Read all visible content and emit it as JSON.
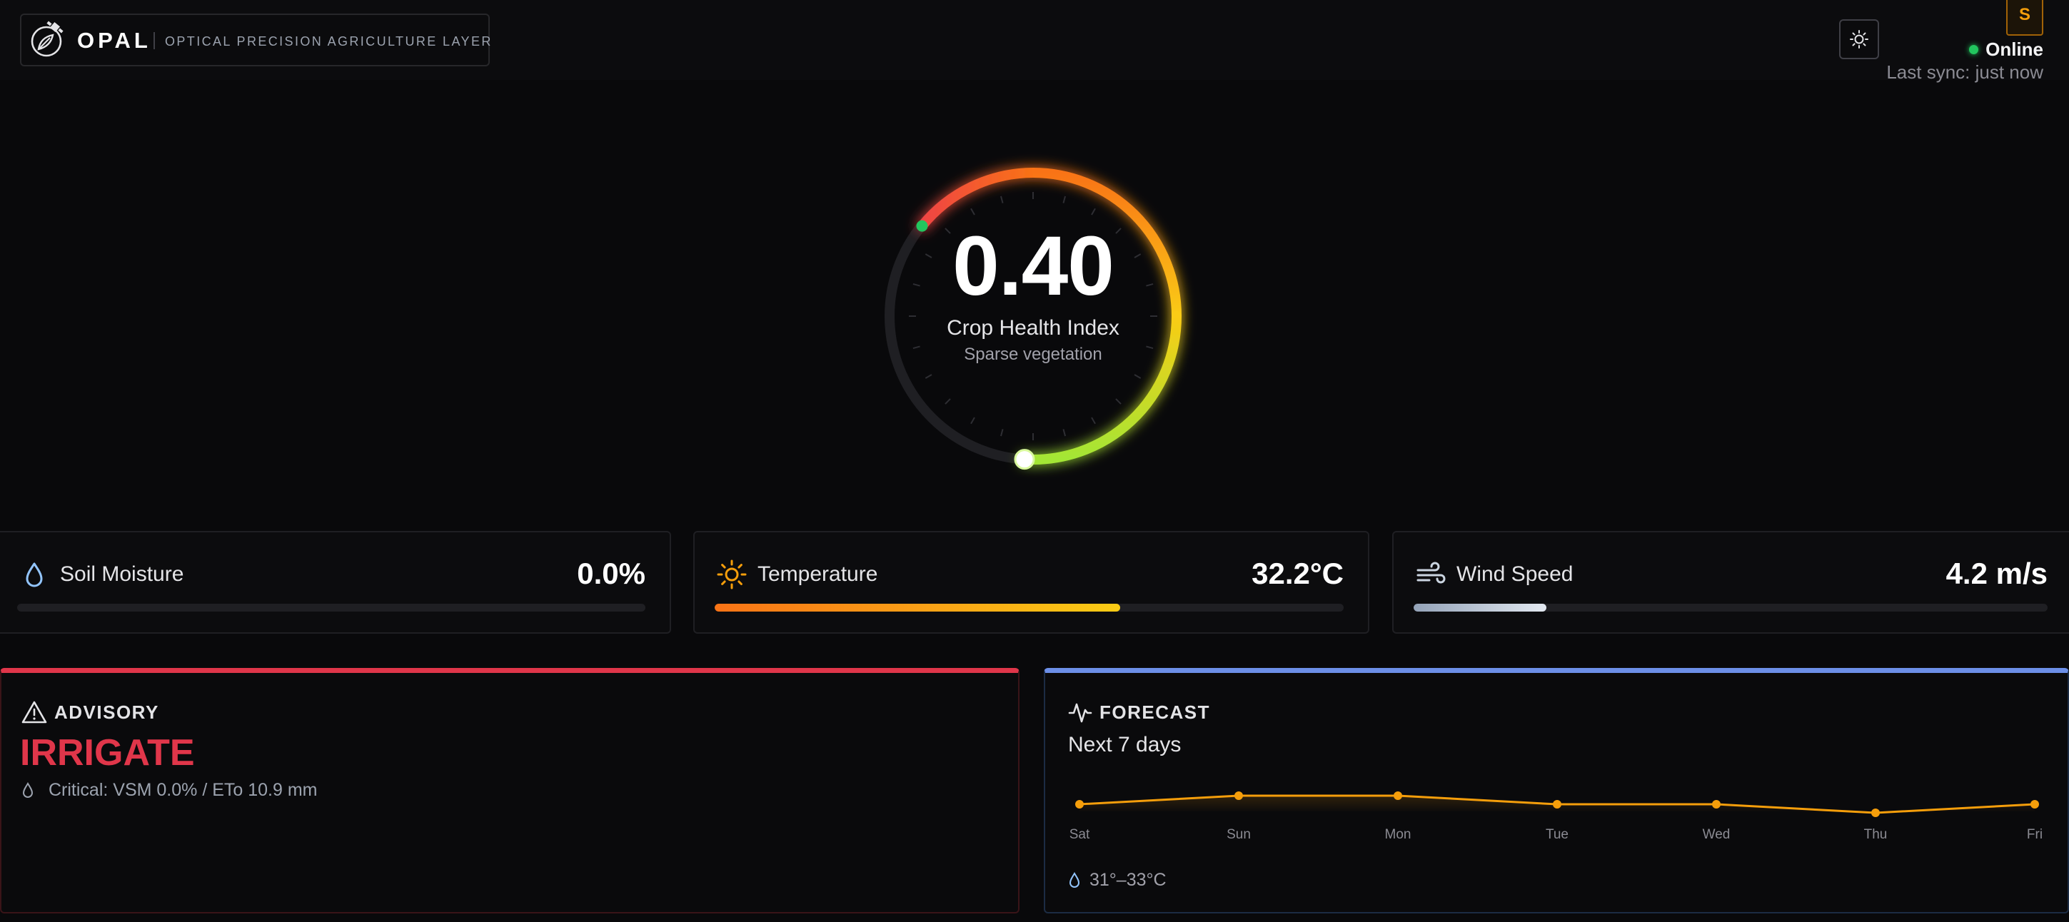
{
  "header": {
    "brand_name": "OPAL",
    "brand_tagline": "OPTICAL PRECISION AGRICULTURE LAYER",
    "user_initial": "S",
    "status": "Online",
    "last_sync": "Last sync: just now",
    "icons": {
      "logo": "satellite-leaf-logo",
      "theme": "sun-icon"
    }
  },
  "gauge": {
    "value": "0.40",
    "label": "Crop Health Index",
    "sublabel": "Sparse vegetation",
    "level": 0.4,
    "colors": [
      "#22c55e",
      "#ef4444",
      "#f97316",
      "#facc15",
      "#a3e635"
    ]
  },
  "metrics": [
    {
      "label": "Soil Moisture",
      "value": "0.0%",
      "fill": 0.0,
      "icon": "droplet-icon",
      "color": "#93c5fd"
    },
    {
      "label": "Temperature",
      "value": "32.2°C",
      "fill": 0.645,
      "icon": "sun-icon",
      "color": "#f59e0b"
    },
    {
      "label": "Wind Speed",
      "value": "4.2 m/s",
      "fill": 0.21,
      "icon": "wind-icon",
      "color": "#cbd5e1"
    }
  ],
  "advisory": {
    "heading": "ADVISORY",
    "action": "IRRIGATE",
    "detail": "Critical: VSM 0.0% / ETo 10.9 mm",
    "accent": "#e0364a"
  },
  "forecast": {
    "heading": "FORECAST",
    "range_title": "Next 7 days",
    "temp_range": "31°–33°C",
    "accent": "#6c8fe8",
    "chart_data": {
      "type": "line",
      "categories": [
        "Sat",
        "Sun",
        "Mon",
        "Tue",
        "Wed",
        "Thu",
        "Fri"
      ],
      "series": [
        {
          "values": [
            32,
            33,
            33,
            32,
            32,
            31,
            32
          ]
        }
      ],
      "ylim": [
        24,
        34
      ],
      "grid": false,
      "color": "#f59e0b"
    }
  }
}
